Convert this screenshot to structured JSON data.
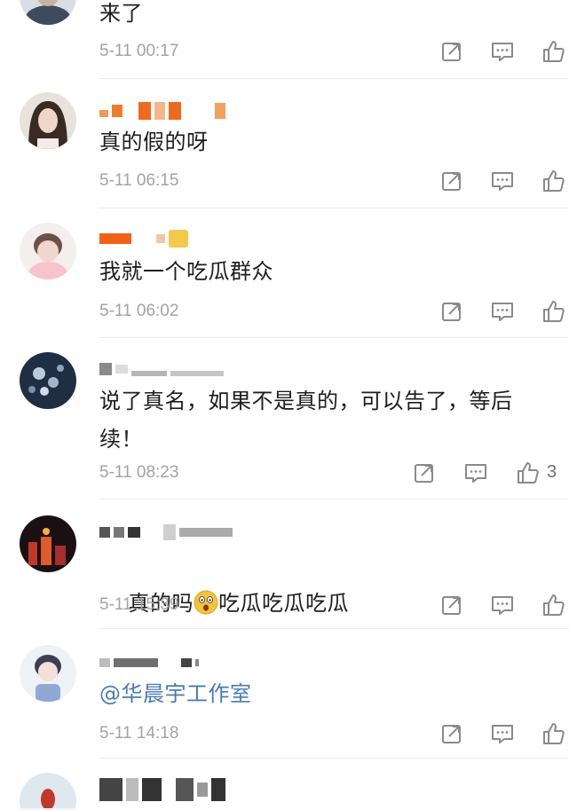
{
  "comments": [
    {
      "text": "来了",
      "time": "5-11 00:17",
      "likes": ""
    },
    {
      "text": "真的假的呀",
      "time": "5-11 06:15",
      "likes": ""
    },
    {
      "text": "我就一个吃瓜群众",
      "time": "5-11 06:02",
      "likes": ""
    },
    {
      "text": "说了真名，如果不是真的，可以告了，等后\n续！",
      "time": "5-11 08:23",
      "likes": "3"
    },
    {
      "text_before": "真的吗",
      "text_after": "吃瓜吃瓜吃瓜",
      "emoji": "astonished-face",
      "time": "5-11 15:39",
      "likes": ""
    },
    {
      "text": "@华晨宇工作室",
      "time": "5-11 14:18",
      "likes": ""
    }
  ],
  "icons": {
    "share": "share-icon",
    "reply": "comment-icon",
    "like": "thumbs-up-icon"
  },
  "colors": {
    "text": "#1d1d1d",
    "timestamp": "#a3a3a3",
    "mention": "#4a7bb7",
    "icon": "#8a8a8a"
  }
}
